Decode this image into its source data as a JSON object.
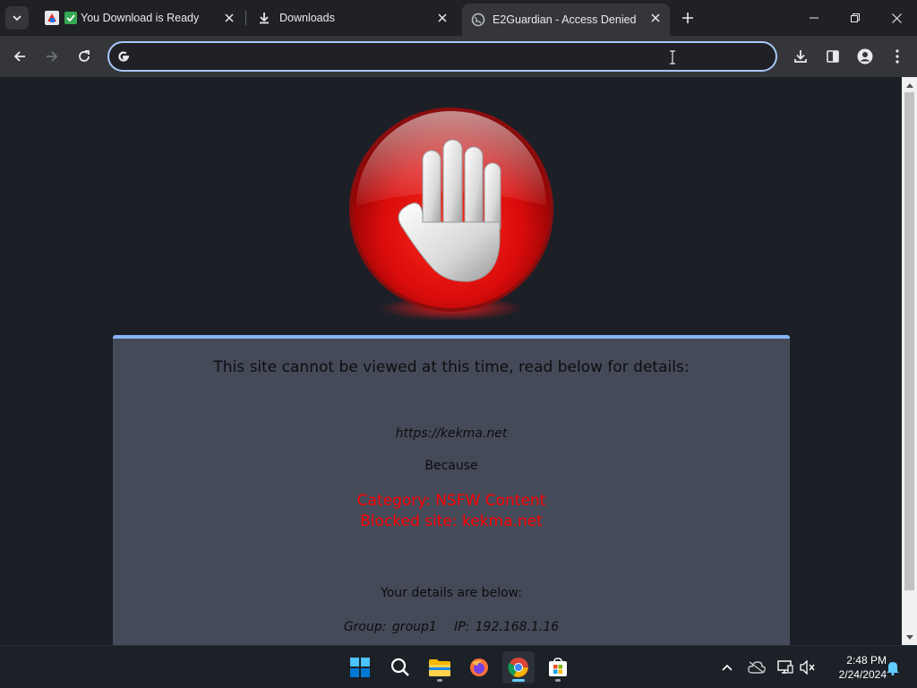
{
  "tabs": [
    {
      "title": "You Download is Ready",
      "active": false
    },
    {
      "title": "Downloads",
      "active": false
    },
    {
      "title": "E2Guardian - Access Denied",
      "active": true
    }
  ],
  "omnibox": {
    "value": "",
    "placeholder": ""
  },
  "page": {
    "heading": "This site cannot be viewed at this time, read below for details:",
    "url": "https://kekma.net",
    "because": "Because",
    "reason_category": "Category: NSFW Content",
    "reason_site": "Blocked site: kekma.net",
    "details_heading": "Your details are below:",
    "details_line": "Group: group1   IP: 192.168.1.16"
  },
  "taskbar": {
    "time": "2:48 PM",
    "date": "2/24/2024"
  },
  "colors": {
    "accent": "#8ab4f8",
    "blocked_text": "#ff0000",
    "panel_bg": "#454a59",
    "page_bg": "#1d1f27"
  }
}
